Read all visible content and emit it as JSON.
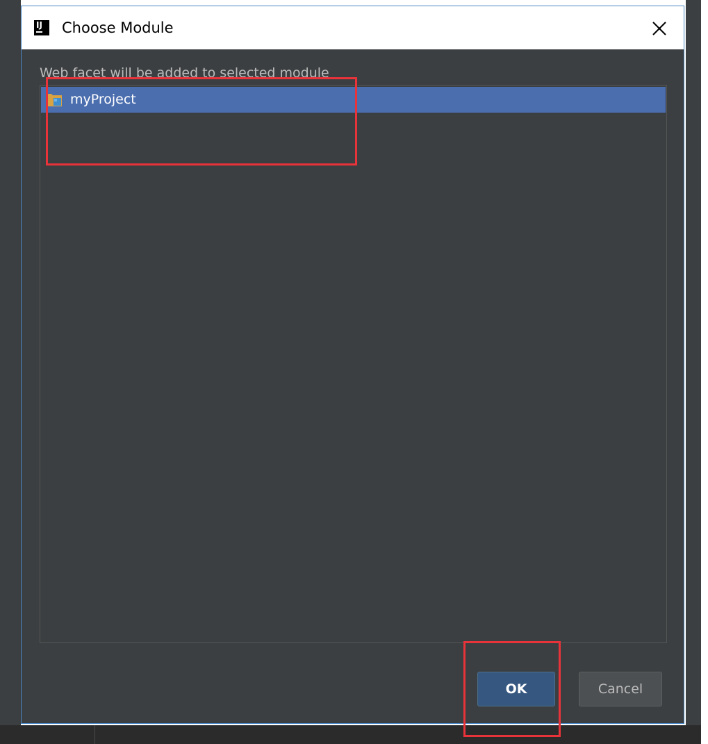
{
  "dialog": {
    "title": "Choose Module",
    "logo_text": "IJ",
    "close_icon": "close-icon",
    "prompt": "Web facet will be added to selected module"
  },
  "modules": [
    {
      "label": "myProject",
      "icon": "module-folder-icon",
      "selected": true
    }
  ],
  "buttons": {
    "ok_label": "OK",
    "cancel_label": "Cancel"
  },
  "colors": {
    "dialog_bg": "#3c3f41",
    "selection": "#4b6eaf",
    "dialog_border": "#4a88c7",
    "ok_button": "#365880",
    "annotation": "#e8333a"
  },
  "annotations": [
    {
      "name": "module-highlight-box",
      "target": "module-row"
    },
    {
      "name": "ok-highlight-box",
      "target": "ok-button"
    }
  ]
}
